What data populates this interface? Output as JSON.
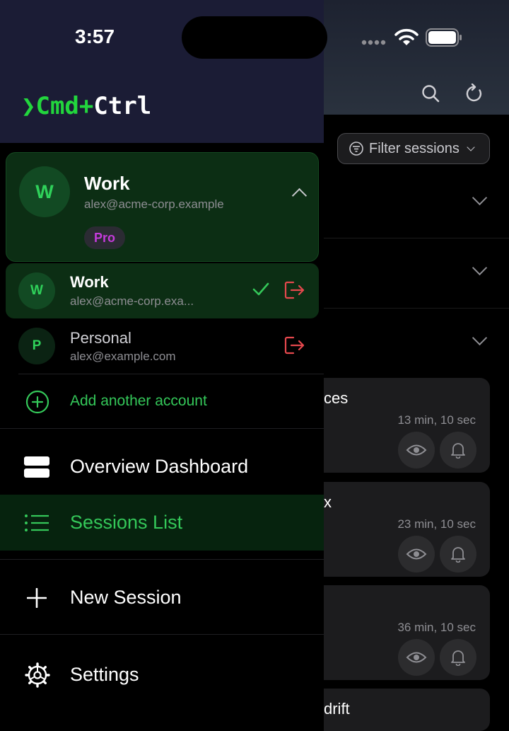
{
  "status_bar": {
    "time": "3:57"
  },
  "app": {
    "logo_prefix": "❯",
    "logo_cmd": "Cmd",
    "logo_plus": "+",
    "logo_ctrl": "Ctrl"
  },
  "current_account": {
    "initial": "W",
    "name": "Work",
    "email": "alex@acme-corp.example",
    "plan": "Pro"
  },
  "accounts": [
    {
      "initial": "W",
      "name": "Work",
      "email": "alex@acme-corp.exa...",
      "selected": true
    },
    {
      "initial": "P",
      "name": "Personal",
      "email": "alex@example.com",
      "selected": false
    }
  ],
  "add_account_label": "Add another account",
  "nav": {
    "overview": "Overview Dashboard",
    "sessions": "Sessions List",
    "new_session": "New Session",
    "settings": "Settings"
  },
  "background": {
    "filter_label": "Filter sessions",
    "sessions": [
      {
        "title_fragment": "ces",
        "duration": "13 min, 10 sec"
      },
      {
        "title_fragment": "x",
        "duration": "23 min, 10 sec"
      },
      {
        "title_fragment": "",
        "duration": "36 min, 10 sec"
      },
      {
        "title_fragment": "drift",
        "duration": ""
      }
    ]
  },
  "colors": {
    "accent_green": "#34c759",
    "logo_green": "#22d63d",
    "danger_red": "#e5484d",
    "pro_purple": "#c53bdc",
    "drawer_header": "#1b1c35"
  }
}
